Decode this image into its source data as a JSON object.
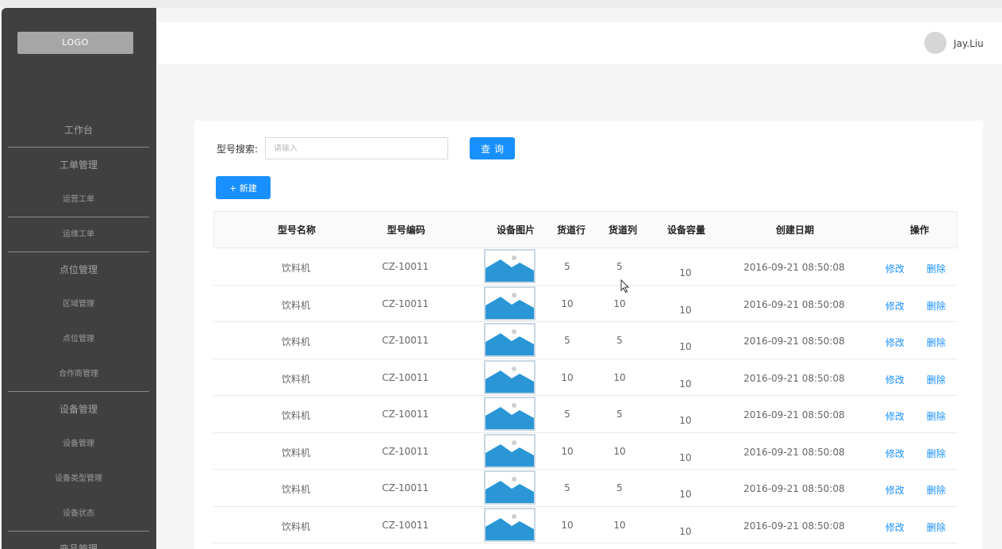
{
  "sidebar": {
    "logo": "LOGO",
    "menu": [
      {
        "label": "工作台",
        "group": true
      },
      {
        "label": "工单管理",
        "group": true
      },
      {
        "label": "运营工单",
        "group": false
      },
      {
        "label": "运维工单",
        "group": false
      },
      {
        "label": "点位管理",
        "group": true
      },
      {
        "label": "区域管理",
        "group": false
      },
      {
        "label": "点位管理",
        "group": false
      },
      {
        "label": "合作商管理",
        "group": false
      },
      {
        "label": "设备管理",
        "group": true
      },
      {
        "label": "设备管理",
        "group": false
      },
      {
        "label": "设备类型管理",
        "group": false
      },
      {
        "label": "设备状态",
        "group": false
      },
      {
        "label": "商品管理",
        "group": true
      }
    ]
  },
  "header": {
    "username": "Jay.Liu"
  },
  "search": {
    "label": "型号搜索:",
    "placeholder": "请输入",
    "query_button": "查询"
  },
  "new_button": "+ 新建",
  "colors": {
    "accent": "#1890ff",
    "sidebar": "#404040",
    "image_blue": "#2a96d6"
  },
  "table": {
    "columns": [
      "型号名称",
      "型号编码",
      "设备图片",
      "货道行",
      "货道列",
      "设备容量",
      "创建日期",
      "操作"
    ],
    "action_edit": "修改",
    "action_delete": "删除",
    "image_icon": "image-placeholder-icon",
    "rows": [
      {
        "name": "饮料机",
        "code": "CZ-10011",
        "rows": "5",
        "cols": "5",
        "capacity": "10",
        "created": "2016-09-21  08:50:08"
      },
      {
        "name": "饮料机",
        "code": "CZ-10011",
        "rows": "10",
        "cols": "10",
        "capacity": "10",
        "created": "2016-09-21  08:50:08"
      },
      {
        "name": "饮料机",
        "code": "CZ-10011",
        "rows": "5",
        "cols": "5",
        "capacity": "10",
        "created": "2016-09-21  08:50:08"
      },
      {
        "name": "饮料机",
        "code": "CZ-10011",
        "rows": "10",
        "cols": "10",
        "capacity": "10",
        "created": "2016-09-21  08:50:08"
      },
      {
        "name": "饮料机",
        "code": "CZ-10011",
        "rows": "5",
        "cols": "5",
        "capacity": "10",
        "created": "2016-09-21  08:50:08"
      },
      {
        "name": "饮料机",
        "code": "CZ-10011",
        "rows": "10",
        "cols": "10",
        "capacity": "10",
        "created": "2016-09-21  08:50:08"
      },
      {
        "name": "饮料机",
        "code": "CZ-10011",
        "rows": "5",
        "cols": "5",
        "capacity": "10",
        "created": "2016-09-21  08:50:08"
      },
      {
        "name": "饮料机",
        "code": "CZ-10011",
        "rows": "10",
        "cols": "10",
        "capacity": "10",
        "created": "2016-09-21  08:50:08"
      }
    ]
  }
}
